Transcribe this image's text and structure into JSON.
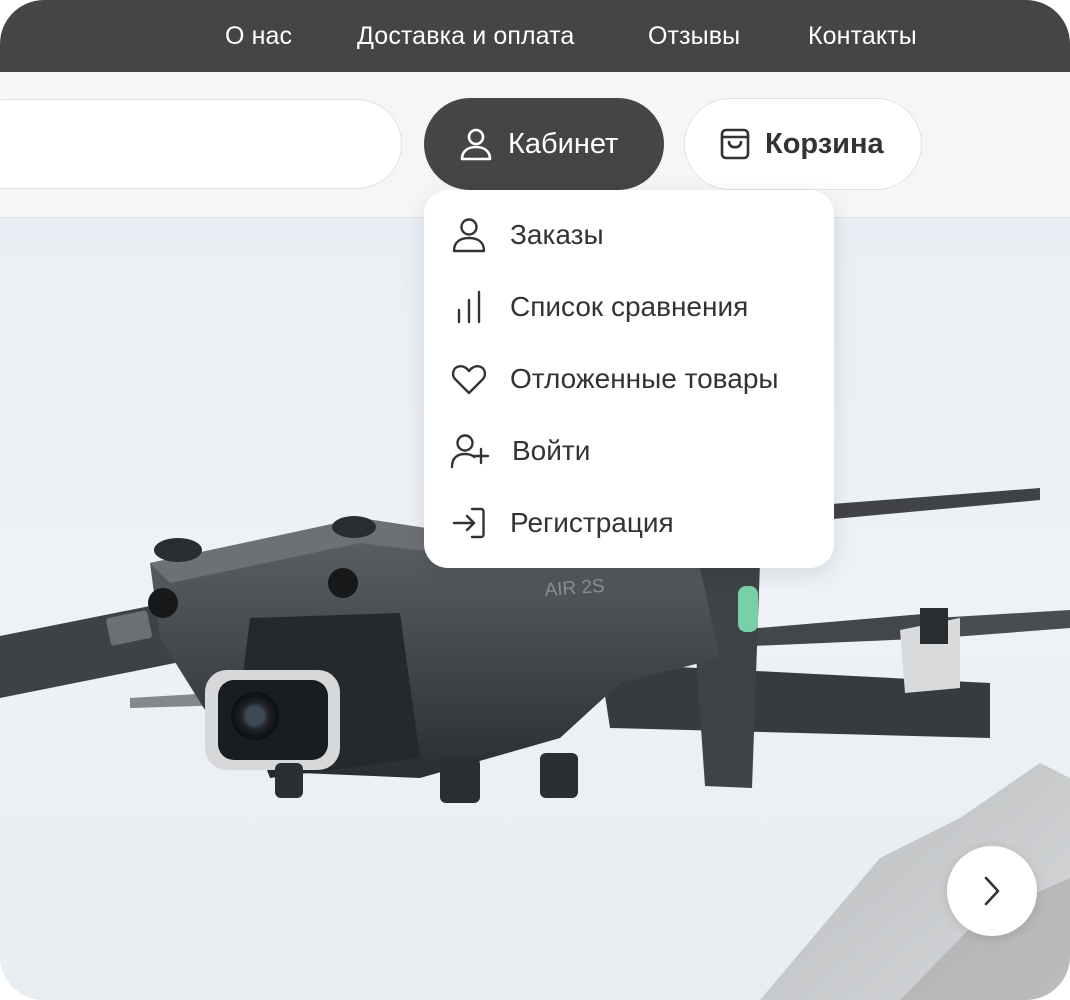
{
  "top_nav": {
    "items": [
      "О нас",
      "Доставка и оплата",
      "Отзывы",
      "Контакты"
    ]
  },
  "header": {
    "search_placeholder": "",
    "cabinet_label": "Кабинет",
    "cart_label": "Корзина"
  },
  "account_menu": {
    "items": [
      {
        "label": "Заказы",
        "icon": "user-icon"
      },
      {
        "label": "Список сравнения",
        "icon": "bar-chart-icon"
      },
      {
        "label": "Отложенные товары",
        "icon": "heart-icon"
      },
      {
        "label": "Войти",
        "icon": "user-plus-icon"
      },
      {
        "label": "Регистрация",
        "icon": "sign-in-arrow-icon"
      }
    ]
  },
  "hero": {
    "image": "drone-photo",
    "drone_label": "AIR 2S",
    "next_icon": "chevron-right-icon"
  },
  "colors": {
    "nav_bg": "#454545",
    "cabinet_bg": "#454545",
    "text_dark": "#333333"
  }
}
